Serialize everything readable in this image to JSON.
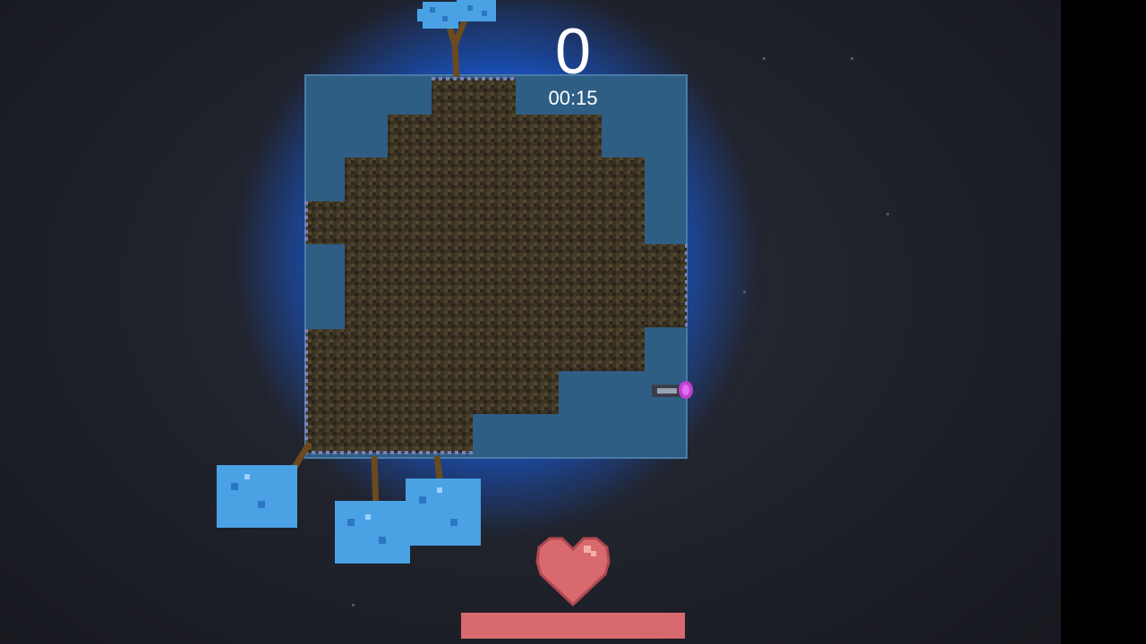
{
  "hud": {
    "score": "0",
    "timer": "00:15"
  },
  "health": {
    "fraction": 1.0
  },
  "colors": {
    "glow": "#1f6cff",
    "board": "#2f5e85",
    "dirt": "#3c3424",
    "leaves": "#4aa2e4",
    "trunk": "#6a4a1e",
    "heart": "#d8696f"
  },
  "icons": {
    "heart": "heart-icon",
    "player": "player-icon"
  }
}
